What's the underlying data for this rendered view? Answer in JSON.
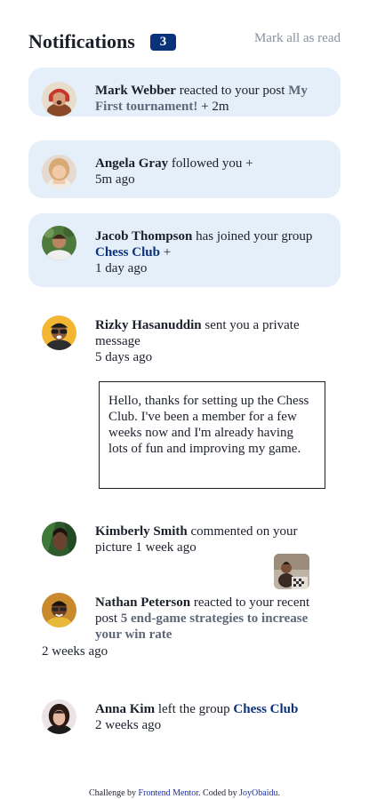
{
  "header": {
    "title": "Notifications",
    "unread_count": "3",
    "mark_all_label": "Mark all as read"
  },
  "notifications": [
    {
      "name": "Mark Webber",
      "action": " reacted to your post ",
      "target": "My First tournament!",
      "dot": " + ",
      "time": "2m",
      "unread": true,
      "avatar": "avatar-mark-webber"
    },
    {
      "name": "Angela Gray",
      "action": " followed you ",
      "dot": "+",
      "time": "5m ago",
      "unread": true,
      "avatar": "avatar-angela-gray"
    },
    {
      "name": "Jacob Thompson",
      "action": " has joined your group ",
      "target": "Chess Club",
      "dot": " +",
      "time": "1 day ago",
      "unread": true,
      "avatar": "avatar-jacob-thompson"
    },
    {
      "name": "Rizky Hasanuddin",
      "action": " sent you a private message",
      "time": "5 days ago",
      "message": "Hello, thanks for setting up the Chess Club. I've been a member for a few weeks now and I'm already having lots of fun and improving my game.",
      "unread": false,
      "avatar": "avatar-rizky-hasanuddin"
    },
    {
      "name": "Kimberly Smith",
      "action": " commented on your picture ",
      "time": "1 week ago",
      "unread": false,
      "avatar": "avatar-kimberly-smith"
    },
    {
      "name": "Nathan Peterson",
      "action": " reacted to your recent post ",
      "target": "5 end-game strategies to increase your win rate",
      "time": "2 weeks ago",
      "unread": false,
      "avatar": "avatar-nathan-peterson"
    },
    {
      "name": "Anna Kim",
      "action": " left the group ",
      "target": "Chess Club",
      "time": "2 weeks ago",
      "unread": false,
      "avatar": "avatar-anna-kim"
    }
  ],
  "footer": {
    "prefix": "Challenge by ",
    "challenge_link": "Frontend Mentor",
    "middle": ". Coded by ",
    "author_link": "JoyObaidu",
    "suffix": "."
  },
  "colors": {
    "unread_bg": "#e5effa",
    "badge_bg": "#0a327b",
    "group_link": "#0a327b",
    "post_link": "#5e6778",
    "muted": "#8a91a1"
  }
}
